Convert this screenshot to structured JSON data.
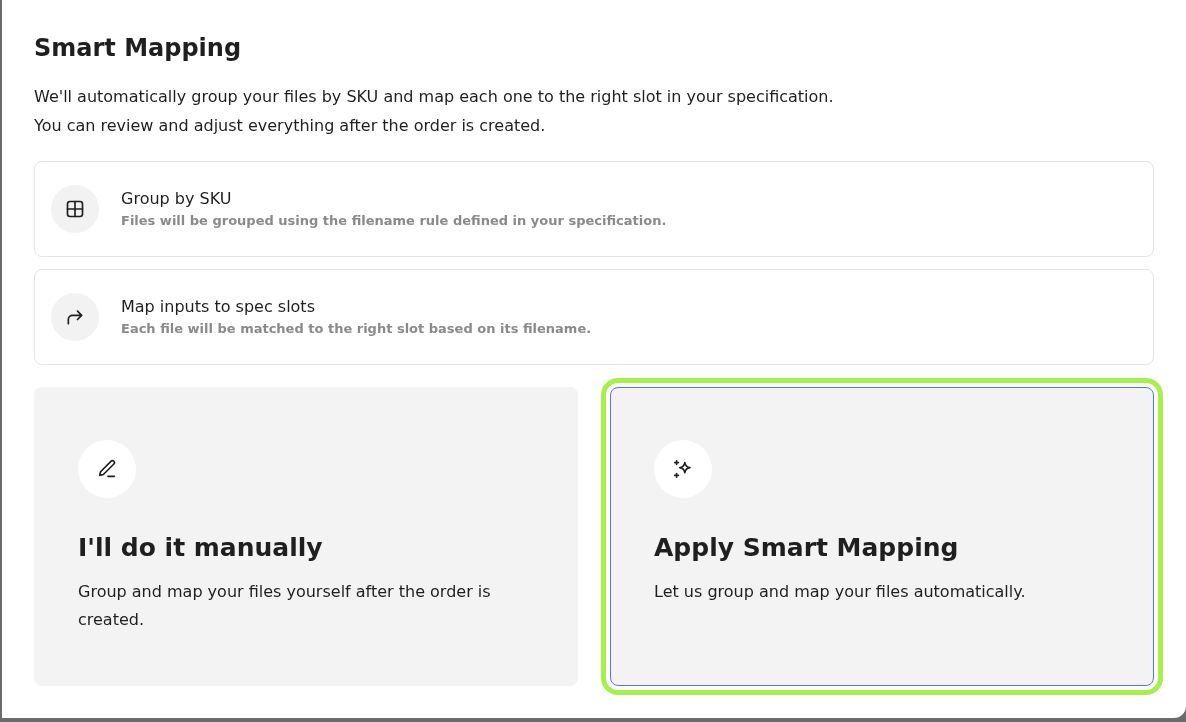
{
  "dialog": {
    "title": "Smart Mapping",
    "description": [
      "We'll automatically group your files by SKU and map each one to the right slot in your specification.",
      "You can review and adjust everything after the order is created."
    ]
  },
  "steps": [
    {
      "kind": "grid",
      "title": "Group by SKU",
      "subtitle": "Files will be grouped using the filename rule defined in your specification."
    },
    {
      "kind": "arrow",
      "title": "Map inputs to spec slots",
      "subtitle": "Each file will be matched to the right slot based on its filename."
    }
  ],
  "options": [
    {
      "kind": "pencil",
      "title": "I'll do it manually",
      "description": "Group and map your files yourself after the order is created.",
      "selected": false
    },
    {
      "kind": "sparkles",
      "title": "Apply Smart Mapping",
      "description": "Let us group and map your files automatically.",
      "selected": true
    }
  ]
}
